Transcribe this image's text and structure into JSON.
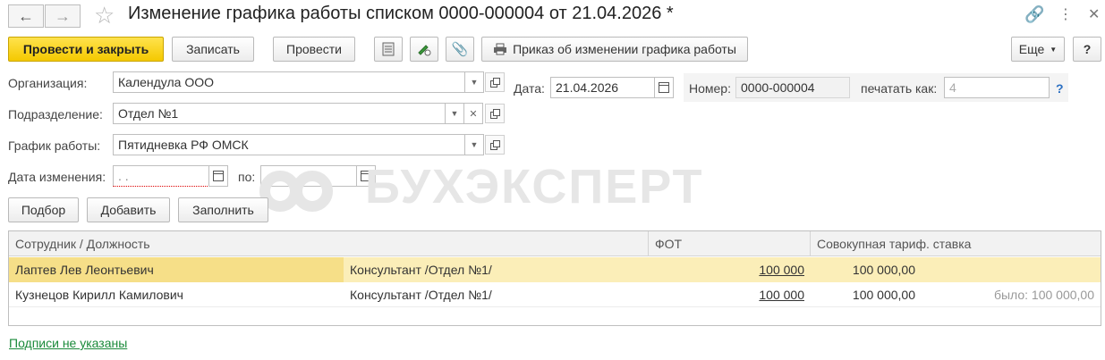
{
  "window": {
    "title": "Изменение графика работы списком 0000-000004 от 21.04.2026 *"
  },
  "toolbar": {
    "post_close": "Провести и закрыть",
    "save": "Записать",
    "post": "Провести",
    "print_order": "Приказ об изменении графика работы",
    "more": "Еще",
    "help": "?"
  },
  "form": {
    "organization_label": "Организация:",
    "organization_value": "Календула ООО",
    "department_label": "Подразделение:",
    "department_value": "Отдел №1",
    "schedule_label": "График работы:",
    "schedule_value": "Пятидневка РФ ОМСК",
    "change_date_label": "Дата изменения:",
    "change_date_value": " .  .",
    "to_label": "по:",
    "to_value": " .  .",
    "date_label": "Дата:",
    "date_value": "21.04.2026",
    "number_label": "Номер:",
    "number_value": "0000-000004",
    "print_as_label": "печатать как:",
    "print_as_value": "4",
    "print_as_help": "?"
  },
  "actions": {
    "select": "Подбор",
    "add": "Добавить",
    "fill": "Заполнить"
  },
  "table": {
    "headers": [
      "Сотрудник / Должность",
      "ФОТ",
      "Совокупная тариф. ставка"
    ],
    "rows": [
      {
        "employee": "Лаптев Лев Леонтьевич",
        "position": "Консультант /Отдел №1/",
        "fot": "100 000",
        "rate": "100 000,00",
        "was": ""
      },
      {
        "employee": "Кузнецов Кирилл Камилович",
        "position": "Консультант /Отдел №1/",
        "fot": "100 000",
        "rate": "100 000,00",
        "was": "было: 100 000,00"
      }
    ]
  },
  "footer": {
    "signatures_link": "Подписи не указаны"
  },
  "watermark": "БУХЭКСПЕРТ",
  "colors": {
    "primary_button": "#f4c900",
    "selected_row": "#fbeeb8",
    "link": "#1a8a3a"
  }
}
